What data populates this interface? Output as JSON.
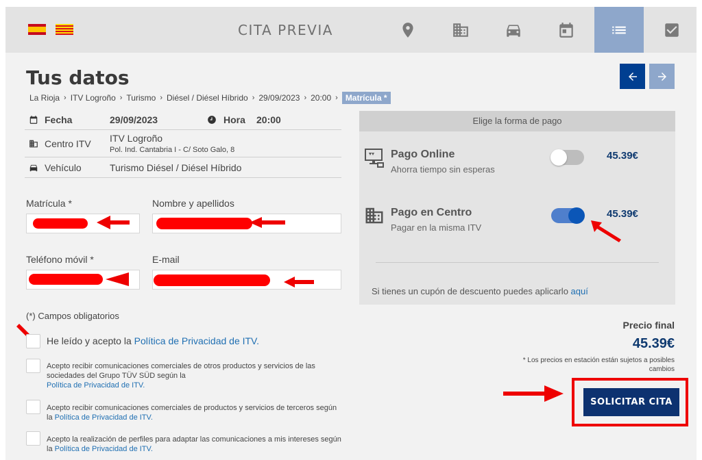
{
  "header": {
    "brand": "CITA PREVIA",
    "flags": [
      "spain-flag",
      "catalonia-flag"
    ],
    "steps": [
      {
        "icon": "location-pin-icon",
        "active": false
      },
      {
        "icon": "building-icon",
        "active": false
      },
      {
        "icon": "car-icon",
        "active": false
      },
      {
        "icon": "calendar-icon",
        "active": false
      },
      {
        "icon": "list-icon",
        "active": true
      },
      {
        "icon": "checkbox-icon",
        "active": false
      }
    ]
  },
  "page": {
    "title": "Tus datos",
    "breadcrumb": [
      "La Rioja",
      "ITV Logroño",
      "Turismo",
      "Diésel / Diésel Híbrido",
      "29/09/2023",
      "20:00",
      "Matrícula *"
    ]
  },
  "summary": {
    "fecha_label": "Fecha",
    "fecha": "29/09/2023",
    "hora_label": "Hora",
    "hora": "20:00",
    "centro_label": "Centro ITV",
    "centro_name": "ITV Logroño",
    "centro_address": "Pol. Ind. Cantabria I - C/ Soto Galo, 8",
    "vehiculo_label": "Vehículo",
    "vehiculo": "Turismo Diésel / Diésel Híbrido"
  },
  "form": {
    "matricula_label": "Matrícula *",
    "nombre_label": "Nombre y apellidos",
    "telefono_label": "Teléfono móvil *",
    "email_label": "E-mail",
    "required_note": "(*) Campos obligatorios",
    "consent1_text": "He leído y acepto la ",
    "consent1_link": "Política de Privacidad de ITV.",
    "consent2_text": "Acepto recibir comunicaciones comerciales de otros productos y servicios de las sociedades del Grupo TÜV SÜD según la",
    "consent2_link": "Política de Privacidad de ITV.",
    "consent3_text": "Acepto recibir comunicaciones comerciales de productos y servicios de terceros según la ",
    "consent3_link": "Política de Privacidad de ITV.",
    "consent4_text": "Acepto la realización de perfiles para adaptar las comunicaciones a mis intereses según la ",
    "consent4_link": "Política de Privacidad de ITV."
  },
  "payment": {
    "heading": "Elige la forma de pago",
    "online_title": "Pago Online",
    "online_sub": "Ahorra tiempo sin esperas",
    "online_price": "45.39€",
    "online_selected": false,
    "centro_title": "Pago en Centro",
    "centro_sub": "Pagar en la misma ITV",
    "centro_price": "45.39€",
    "centro_selected": true,
    "coupon_text": "Si tienes un cupón de descuento puedes aplicarlo ",
    "coupon_link": "aquí"
  },
  "price": {
    "label": "Precio final",
    "value": "45.39€",
    "note": "* Los precios en estación están sujetos a posibles cambios"
  },
  "cta": {
    "label": "SOLICITAR CITA"
  },
  "colors": {
    "primary": "#0d3270",
    "accent": "#8ea7cb",
    "annotation": "#ee0000"
  }
}
